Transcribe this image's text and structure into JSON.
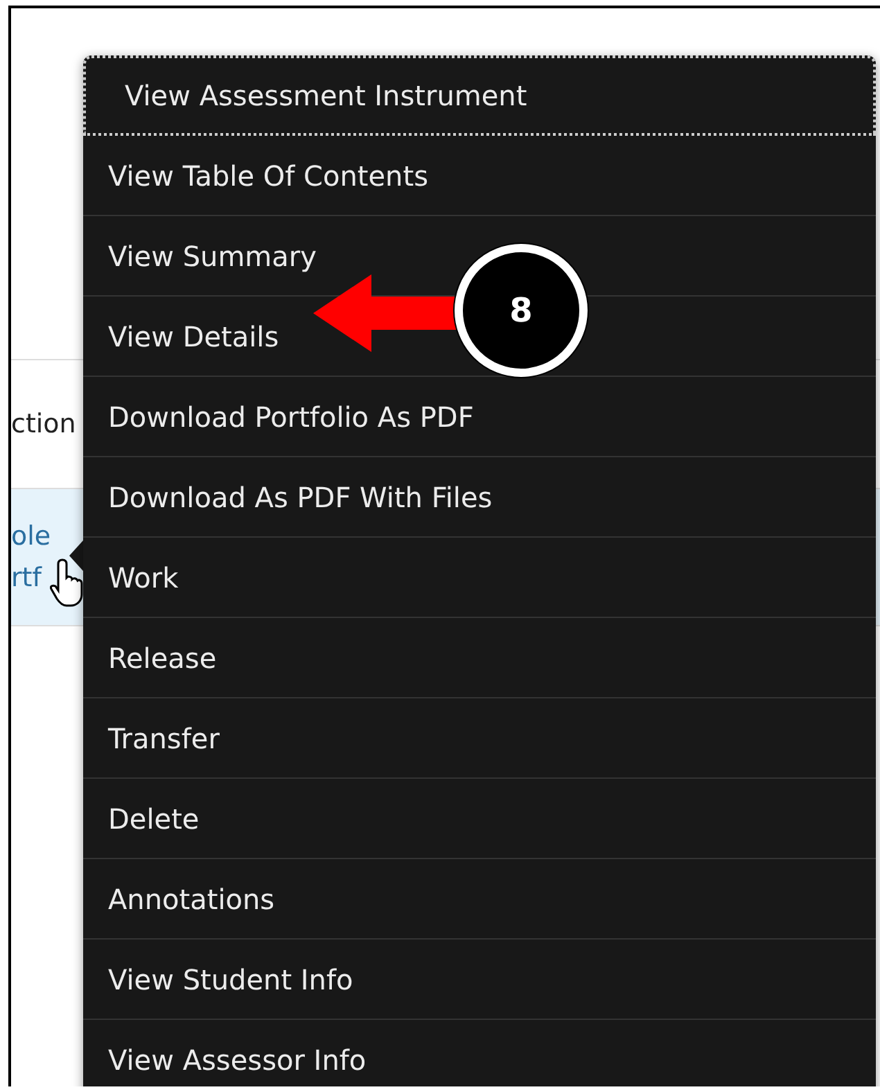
{
  "table": {
    "columns": [
      "ction"
    ],
    "rows": [
      {
        "selected": true,
        "cells": [
          [
            "ole",
            "rtf"
          ]
        ]
      }
    ]
  },
  "menu": {
    "items": [
      {
        "label": "View Assessment Instrument",
        "focused": true
      },
      {
        "label": "View Table Of Contents",
        "focused": false
      },
      {
        "label": "View Summary",
        "focused": false
      },
      {
        "label": "View Details",
        "focused": false
      },
      {
        "label": "Download Portfolio As PDF",
        "focused": false
      },
      {
        "label": "Download As PDF With Files",
        "focused": false
      },
      {
        "label": "Work",
        "focused": false
      },
      {
        "label": "Release",
        "focused": false
      },
      {
        "label": "Transfer",
        "focused": false
      },
      {
        "label": "Delete",
        "focused": false
      },
      {
        "label": "Annotations",
        "focused": false
      },
      {
        "label": "View Student Info",
        "focused": false
      },
      {
        "label": "View Assessor Info",
        "focused": false
      }
    ]
  },
  "callout": {
    "number": "8"
  }
}
